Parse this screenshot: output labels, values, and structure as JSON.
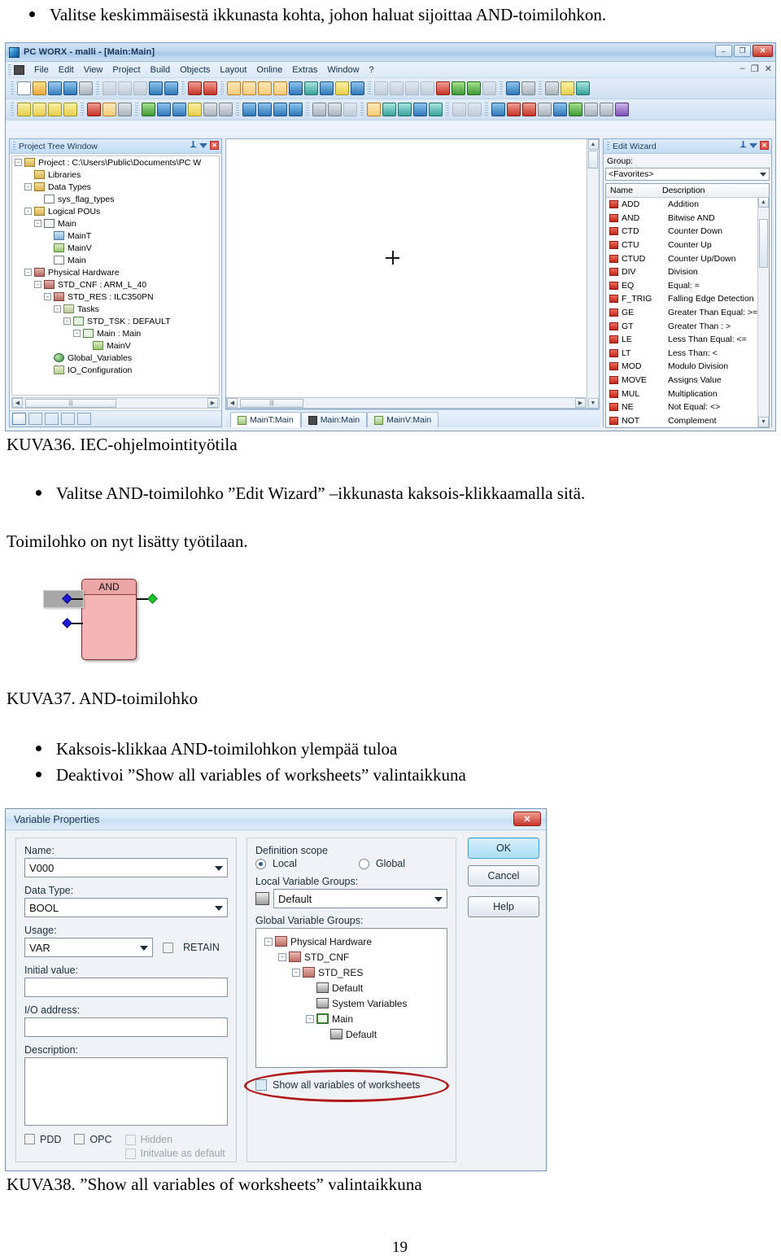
{
  "document": {
    "top_bullet": "Valitse keskimmäisestä ikkunasta kohta, johon haluat sijoittaa AND-toimilohkon.",
    "caption_36": "KUVA36. IEC-ohjelmointityötila",
    "bullet_36": "Valitse AND-toimilohko ”Edit Wizard” –ikkunasta kaksois-klikkaamalla sitä.",
    "line_added": "Toimilohko on nyt lisätty työtilaan.",
    "caption_37": "KUVA37. AND-toimilohko",
    "bullet_37a": "Kaksois-klikkaa AND-toimilohkon ylempää tuloa",
    "bullet_37b": "Deaktivoi ”Show all variables of worksheets” valintaikkuna",
    "caption_38": "KUVA38. ”Show all variables of worksheets” valintaikkuna",
    "page_number": "19"
  },
  "pcworx": {
    "title": "PC WORX - malli - [Main:Main]",
    "window_buttons": {
      "minimize": "–",
      "maximize": "❐",
      "close": "✕"
    },
    "mdi_buttons": {
      "minimize": "–",
      "restore": "❐",
      "close": "✕"
    },
    "menu": [
      "File",
      "Edit",
      "View",
      "Project",
      "Build",
      "Objects",
      "Layout",
      "Online",
      "Extras",
      "Window",
      "?"
    ],
    "project_tree": {
      "title": "Project Tree Window",
      "nodes": [
        {
          "depth": 0,
          "exp": "-",
          "icon": "folder",
          "label": "Project : C:\\Users\\Public\\Documents\\PC W"
        },
        {
          "depth": 1,
          "exp": "",
          "icon": "folder",
          "label": "Libraries"
        },
        {
          "depth": 1,
          "exp": "-",
          "icon": "folder",
          "label": "Data Types"
        },
        {
          "depth": 2,
          "exp": "",
          "icon": "doc",
          "label": "sys_flag_types"
        },
        {
          "depth": 1,
          "exp": "-",
          "icon": "folder",
          "label": "Logical POUs"
        },
        {
          "depth": 2,
          "exp": "-",
          "icon": "sq",
          "label": "Main"
        },
        {
          "depth": 3,
          "exp": "",
          "icon": "blue",
          "label": "MainT"
        },
        {
          "depth": 3,
          "exp": "",
          "icon": "green",
          "label": "MainV"
        },
        {
          "depth": 3,
          "exp": "",
          "icon": "doc",
          "label": "Main"
        },
        {
          "depth": 1,
          "exp": "-",
          "icon": "hw",
          "label": "Physical Hardware"
        },
        {
          "depth": 2,
          "exp": "-",
          "icon": "hw",
          "label": "STD_CNF : ARM_L_40"
        },
        {
          "depth": 3,
          "exp": "-",
          "icon": "hw",
          "label": "STD_RES : ILC350PN"
        },
        {
          "depth": 4,
          "exp": "-",
          "icon": "folder-g",
          "label": "Tasks"
        },
        {
          "depth": 5,
          "exp": "-",
          "icon": "sq-g",
          "label": "STD_TSK : DEFAULT"
        },
        {
          "depth": 6,
          "exp": "-",
          "icon": "sq-g",
          "label": "Main : Main"
        },
        {
          "depth": 7,
          "exp": "",
          "icon": "green",
          "label": "MainV"
        },
        {
          "depth": 3,
          "exp": "",
          "icon": "globe",
          "label": "Global_Variables"
        },
        {
          "depth": 3,
          "exp": "",
          "icon": "io",
          "label": "IO_Configuration"
        }
      ]
    },
    "editor": {
      "tabs": [
        {
          "label": "MainT:Main",
          "active": true,
          "icon": "green"
        },
        {
          "label": "Main:Main",
          "active": false,
          "icon": "dark"
        },
        {
          "label": "MainV:Main",
          "active": false,
          "icon": "green"
        }
      ]
    },
    "edit_wizard": {
      "title": "Edit Wizard",
      "group_label": "Group:",
      "group_value": "<Favorites>",
      "col_name": "Name",
      "col_description": "Description",
      "items": [
        {
          "name": "ADD",
          "description": "Addition"
        },
        {
          "name": "AND",
          "description": "Bitwise AND"
        },
        {
          "name": "CTD",
          "description": "Counter Down"
        },
        {
          "name": "CTU",
          "description": "Counter Up"
        },
        {
          "name": "CTUD",
          "description": "Counter Up/Down"
        },
        {
          "name": "DIV",
          "description": "Division"
        },
        {
          "name": "EQ",
          "description": "Equal: ="
        },
        {
          "name": "F_TRIG",
          "description": "Falling Edge Detection"
        },
        {
          "name": "GE",
          "description": "Greater Than Equal: >="
        },
        {
          "name": "GT",
          "description": "Greater Than : >"
        },
        {
          "name": "LE",
          "description": "Less Than Equal: <="
        },
        {
          "name": "LT",
          "description": "Less Than: <"
        },
        {
          "name": "MOD",
          "description": "Modulo Division"
        },
        {
          "name": "MOVE",
          "description": "Assigns Value"
        },
        {
          "name": "MUL",
          "description": "Multiplication"
        },
        {
          "name": "NE",
          "description": "Not Equal: <>"
        },
        {
          "name": "NOT",
          "description": "Complement"
        }
      ]
    }
  },
  "and_block": {
    "title": "AND"
  },
  "variable_properties": {
    "title": "Variable Properties",
    "close_label": "✕",
    "name_label": "Name:",
    "name_value": "V000",
    "datatype_label": "Data Type:",
    "datatype_value": "BOOL",
    "usage_label": "Usage:",
    "usage_value": "VAR",
    "retain_label": "RETAIN",
    "initial_label": "Initial value:",
    "initial_value": "",
    "io_label": "I/O address:",
    "io_value": "",
    "description_label": "Description:",
    "description_value": "",
    "pdd_label": "PDD",
    "opc_label": "OPC",
    "hidden_label": "Hidden",
    "initvalue_default_label": "Initvalue as default",
    "scope_legend": "Definition scope",
    "scope_local": "Local",
    "scope_global": "Global",
    "local_groups_label": "Local Variable Groups:",
    "local_groups_value": "Default",
    "global_groups_label": "Global Variable Groups:",
    "global_tree": [
      {
        "depth": 0,
        "exp": "-",
        "icon": "hw",
        "label": "Physical Hardware"
      },
      {
        "depth": 1,
        "exp": "-",
        "icon": "hw",
        "label": "STD_CNF"
      },
      {
        "depth": 2,
        "exp": "-",
        "icon": "hw",
        "label": "STD_RES"
      },
      {
        "depth": 3,
        "exp": "",
        "icon": "grp",
        "label": "Default"
      },
      {
        "depth": 3,
        "exp": "",
        "icon": "grp",
        "label": "System Variables"
      },
      {
        "depth": 3,
        "exp": "-",
        "icon": "prog",
        "label": "Main"
      },
      {
        "depth": 4,
        "exp": "",
        "icon": "grp",
        "label": "Default"
      }
    ],
    "show_all_label": "Show all variables of worksheets",
    "buttons": {
      "ok": "OK",
      "cancel": "Cancel",
      "help": "Help"
    }
  },
  "colors": {
    "highlight_ellipse": "#b01818",
    "fb_body": "#f6b5b5",
    "accent_blue": "#2f6aa8"
  }
}
